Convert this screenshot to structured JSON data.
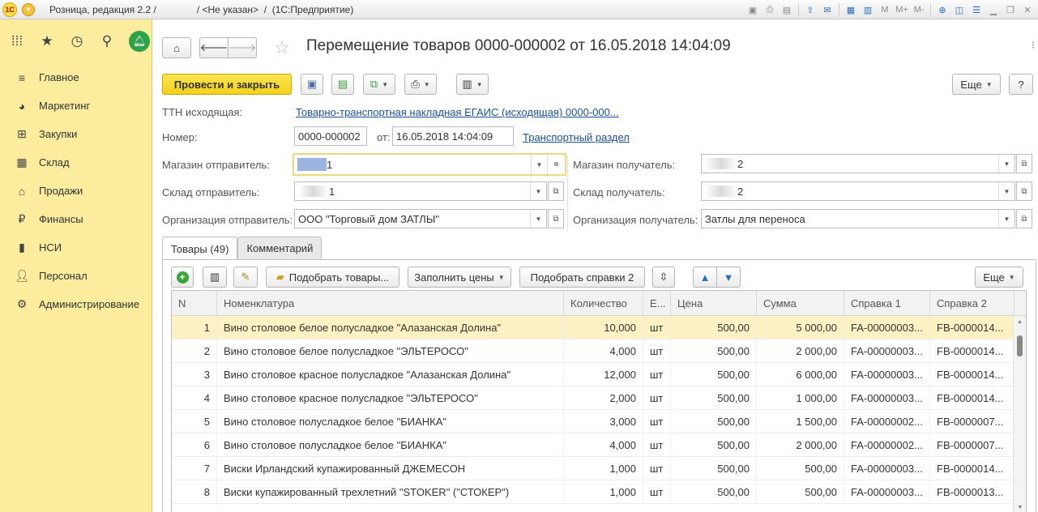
{
  "window": {
    "title": "Розница, редакция 2.2 /               / <Не указан>  /  (1С:Предприятие)",
    "toolbar_icons": [
      "save-icon",
      "print-icon",
      "preview-icon",
      "export-icon",
      "email-icon",
      "calendar-icon",
      "calculator-icon",
      "memory-icon",
      "memory-plus-icon",
      "memory-minus-icon",
      "zoom-icon",
      "panels-icon",
      "settings-icon",
      "minimize-icon",
      "restore-icon",
      "close-icon"
    ],
    "m_label": "M",
    "m_plus_label": "M+",
    "m_minus_label": "M-"
  },
  "sidebar": {
    "items": [
      {
        "label": "Главное",
        "icon": "menu-lines-icon"
      },
      {
        "label": "Маркетинг",
        "icon": "pie-chart-icon"
      },
      {
        "label": "Закупки",
        "icon": "cart-icon"
      },
      {
        "label": "Склад",
        "icon": "warehouse-icon"
      },
      {
        "label": "Продажи",
        "icon": "basket-icon"
      },
      {
        "label": "Финансы",
        "icon": "ruble-icon"
      },
      {
        "label": "НСИ",
        "icon": "bars-icon"
      },
      {
        "label": "Персонал",
        "icon": "person-icon"
      },
      {
        "label": "Администрирование",
        "icon": "gear-icon"
      }
    ]
  },
  "doc": {
    "title": "Перемещение товаров 0000-000002 от 16.05.2018 14:04:09",
    "post_close_label": "Провести и закрыть",
    "more_label": "Еще",
    "help_label": "?",
    "ttn_label": "ТТН исходящая:",
    "ttn_link": "Товарно-транспортная накладная ЕГАИС (исходящая) 0000-000...",
    "number_label": "Номер:",
    "number_value": "0000-000002",
    "from_label": "от:",
    "date_value": "16.05.2018 14:04:09",
    "transport_link": "Транспортный раздел",
    "store_from_label": "Магазин отправитель:",
    "store_from_value": "1",
    "store_to_label": "Магазин получатель:",
    "store_to_value": "2",
    "wh_from_label": "Склад отправитель:",
    "wh_from_value": "1",
    "wh_to_label": "Склад получатель:",
    "wh_to_value": "2",
    "org_from_label": "Организация отправитель:",
    "org_from_value": "ООО \"Торговый дом ЗАТЛЫ\"",
    "org_to_label": "Организация получатель:",
    "org_to_value": "Затлы для переноса"
  },
  "tabs": [
    {
      "label": "Товары (49)",
      "active": true
    },
    {
      "label": "Комментарий",
      "active": false
    }
  ],
  "goods_toolbar": {
    "pick_goods_label": "Подобрать товары...",
    "fill_prices_label": "Заполнить цены",
    "pick_certs_label": "Подобрать справки 2",
    "more_label": "Еще"
  },
  "table": {
    "columns": [
      "N",
      "Номенклатура",
      "Количество",
      "Е...",
      "Цена",
      "Сумма",
      "Справка 1",
      "Справка 2"
    ],
    "rows": [
      [
        "1",
        "Вино столовое белое полусладкое \"Алазанская Долина\"",
        "10,000",
        "шт",
        "500,00",
        "5 000,00",
        "FA-00000003...",
        "FB-0000014..."
      ],
      [
        "2",
        "Вино столовое белое полусладкое \"ЭЛЬТЕРОСО\"",
        "4,000",
        "шт",
        "500,00",
        "2 000,00",
        "FA-00000003...",
        "FB-0000014..."
      ],
      [
        "3",
        "Вино столовое красное полусладкое \"Алазанская Долина\"",
        "12,000",
        "шт",
        "500,00",
        "6 000,00",
        "FA-00000003...",
        "FB-0000014..."
      ],
      [
        "4",
        "Вино столовое красное полусладкое \"ЭЛЬТЕРОСО\"",
        "2,000",
        "шт",
        "500,00",
        "1 000,00",
        "FA-00000003...",
        "FB-0000014..."
      ],
      [
        "5",
        "Вино столовое полусладкое белое \"БИАНКА\"",
        "3,000",
        "шт",
        "500,00",
        "1 500,00",
        "FA-00000002...",
        "FB-0000007..."
      ],
      [
        "6",
        "Вино столовое полусладкое белое \"БИАНКА\"",
        "4,000",
        "шт",
        "500,00",
        "2 000,00",
        "FA-00000002...",
        "FB-0000007..."
      ],
      [
        "7",
        "Виски Ирландский купажированный ДЖЕМЕСОН",
        "1,000",
        "шт",
        "500,00",
        "500,00",
        "FA-00000003...",
        "FB-0000014..."
      ],
      [
        "8",
        "Виски купажированный трехлетний \"STOKER\" (\"СТОКЕР\")",
        "1,000",
        "шт",
        "500,00",
        "500,00",
        "FA-00000003...",
        "FB-0000013..."
      ]
    ],
    "selected_row": 0
  }
}
